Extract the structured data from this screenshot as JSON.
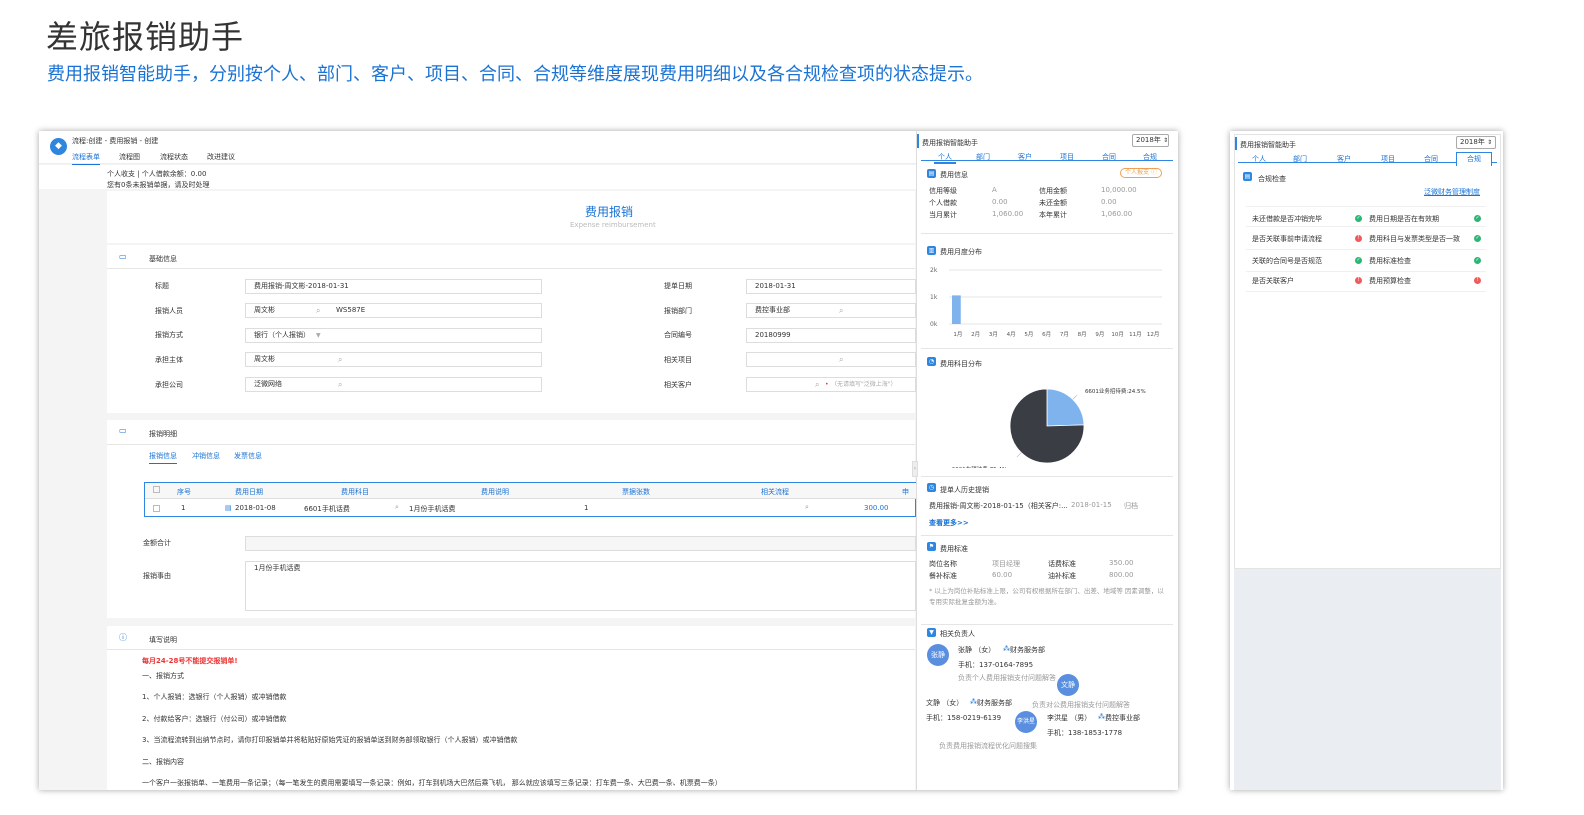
{
  "hero": {
    "title": "差旅报销助手",
    "subtitle": "费用报销智能助手，分别按个人、部门、客户、项目、合同、合规等维度展现费用明细以及各合规检查项的状态提示。"
  },
  "app": {
    "breadcrumb": "流程:创建 - 费用报销 - 创建",
    "tabs": [
      "流程表单",
      "流程图",
      "流程状态",
      "改进建议"
    ],
    "notice1": "个人收支 | 个人借款余额：0.00",
    "notice2": "您有0条未报销单据，请及时处理",
    "form_title": "费用报销",
    "form_subtitle": "Expense reimbursement",
    "basic": {
      "heading": "基础信息",
      "title_label": "标题",
      "title_value": "费用报销-周文彬-2018-01-31",
      "date_label": "提单日期",
      "date_value": "2018-01-31",
      "person_label": "报销人员",
      "person_value": "周文彬",
      "person_code": "WS587E",
      "dept_label": "报销部门",
      "dept_value": "费控事业部",
      "method_label": "报销方式",
      "method_value": "银行（个人报销）",
      "contract_label": "合同编号",
      "contract_value": "20180999",
      "subject_label": "承担主体",
      "subject_value": "周文彬",
      "project_label": "相关项目",
      "company_label": "承担公司",
      "company_value": "泛微网络",
      "client_label": "相关客户",
      "client_hint": "（无请填写\"泛微上海\"）"
    },
    "detail": {
      "heading": "报销明细",
      "subtabs": [
        "报销信息",
        "冲销信息",
        "发票信息"
      ],
      "columns": [
        "序号",
        "费用日期",
        "费用科目",
        "费用说明",
        "票据张数",
        "相关流程",
        "申"
      ],
      "row": {
        "no": "1",
        "date": "2018-01-08",
        "subject": "6601手机话费",
        "desc": "1月份手机话费",
        "count": "1",
        "amount": "300.00"
      },
      "total_label": "金额合计",
      "reason_label": "报销事由",
      "reason_value": "1月份手机话费"
    },
    "instructions": {
      "heading": "填写说明",
      "warning": "每月24-28号不能提交报销单!",
      "lines": [
        "一、报销方式",
        "1、个人报销：选银行（个人报销）或冲销借款",
        "2、付款给客户：选银行（付公司）或冲销借款",
        "3、当流程流转到出纳节点时，请你打印报销单并将粘贴好原始凭证的报销单送到财务部领取银行（个人报销）或冲销借款",
        "二、报销内容",
        "一个客户一张报销单、一笔费用一条记录；（每一笔发生的费用需要填写一条记录：例如，打车到机场大巴然后乘飞机， 那么就应该填写三条记录：打车费一条、大巴费一条、机票费一条）"
      ]
    }
  },
  "assistant": {
    "title": "费用报销智能助手",
    "year": "2018年",
    "tabs": [
      "个人",
      "部门",
      "客户",
      "项目",
      "合同",
      "合规"
    ],
    "fee_info": {
      "heading": "费用信息",
      "badge": "个人报支 ",
      "rows": [
        {
          "l1": "信用等级",
          "v1": "A",
          "l2": "信用金额",
          "v2": "10,000.00"
        },
        {
          "l1": "个人借款",
          "v1": "0.00",
          "l2": "未还金额",
          "v2": "0.00"
        },
        {
          "l1": "当月累计",
          "v1": "1,060.00",
          "l2": "本年累计",
          "v2": "1,060.00"
        }
      ]
    },
    "monthly": {
      "heading": "费用月度分布"
    },
    "subject_dist": {
      "heading": "费用科目分布"
    },
    "history": {
      "heading": "提单人历史提销",
      "item": "费用报销-周文彬-2018-01-15（相关客户:...",
      "item_date": "2018-01-15",
      "item_status": "归档",
      "more": "查看更多>>"
    },
    "standard": {
      "heading": "费用标准",
      "rows": [
        {
          "l1": "岗位名称",
          "v1": "项目经理",
          "l2": "话费标准",
          "v2": "350.00"
        },
        {
          "l1": "餐补标准",
          "v1": "60.00",
          "l2": "油补标准",
          "v2": "800.00"
        }
      ],
      "note": "* 以上为岗位补贴标准上限，公司有权根据所在部门、出差、地域等 因素调整，以专用实际批复金额为准。"
    },
    "contacts": {
      "heading": "相关负责人",
      "people": [
        {
          "avatar": "张静",
          "name": "张静 （女）",
          "dept": "财务服务部",
          "phone": "手机：137-0164-7895",
          "desc": "负责个人费用报销支付问题解答"
        },
        {
          "avatar": "文静",
          "name": "文静 （女）",
          "dept": "财务服务部",
          "phone": "手机：158-0219-6139",
          "desc": "负责对公费用报销支付问题解答"
        },
        {
          "avatar": "李洪星",
          "name": "李洪星 （男）",
          "dept": "费控事业部",
          "phone": "手机：138-1853-1778",
          "desc": "负责费用报销流程优化问题搜集"
        }
      ]
    }
  },
  "compliance": {
    "title": "费用报销智能助手",
    "year": "2018年",
    "tabs": [
      "个人",
      "部门",
      "客户",
      "项目",
      "合同",
      "合规"
    ],
    "heading": "合规检查",
    "link": "泛微财务管理制度",
    "items": [
      {
        "label": "未还借款是否冲销完毕",
        "status": "ok"
      },
      {
        "label": "费用日期是否在有效期",
        "status": "ok"
      },
      {
        "label": "是否关联事前申请流程",
        "status": "bad"
      },
      {
        "label": "费用科目与发票类型是否一致",
        "status": "ok"
      },
      {
        "label": "关联的合同号是否规范",
        "status": "ok"
      },
      {
        "label": "费用标准检查",
        "status": "ok"
      },
      {
        "label": "是否关联客户",
        "status": "bad"
      },
      {
        "label": "费用预算检查",
        "status": "bad"
      }
    ]
  },
  "chart_data": [
    {
      "type": "bar",
      "categories": [
        "1月",
        "2月",
        "3月",
        "4月",
        "5月",
        "6月",
        "7月",
        "8月",
        "9月",
        "10月",
        "11月",
        "12月"
      ],
      "values": [
        1060,
        0,
        0,
        0,
        0,
        0,
        0,
        0,
        0,
        0,
        0,
        0
      ],
      "yticks": [
        "2k",
        "1k",
        "0k"
      ],
      "ylim": [
        0,
        2000
      ]
    },
    {
      "type": "pie",
      "series": [
        {
          "name": "6601业务招待费",
          "value": 24.5,
          "label": "6601业务招待费:24.5%",
          "color": "#7fb3ee"
        },
        {
          "name": "6601车辆油费",
          "value": 75.4,
          "label": "6601车辆油费:75.4%",
          "color": "#3a3d44"
        }
      ]
    }
  ]
}
